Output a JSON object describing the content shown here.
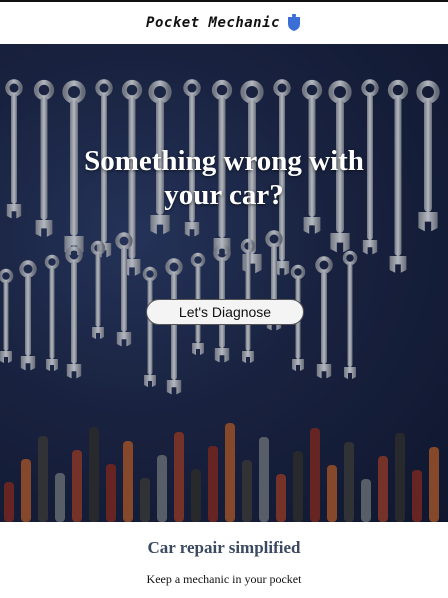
{
  "header": {
    "brand": "Pocket Mechanic",
    "logo_icon": "shield-wrench-icon",
    "accent": "#3b6fd6"
  },
  "hero": {
    "background": "wrench-wall-photo",
    "headline": "Something wrong with your car?",
    "cta_label": "Let's Diagnose"
  },
  "footer": {
    "tagline": "Car repair simplified",
    "subtagline": "Keep a mechanic in your pocket"
  }
}
